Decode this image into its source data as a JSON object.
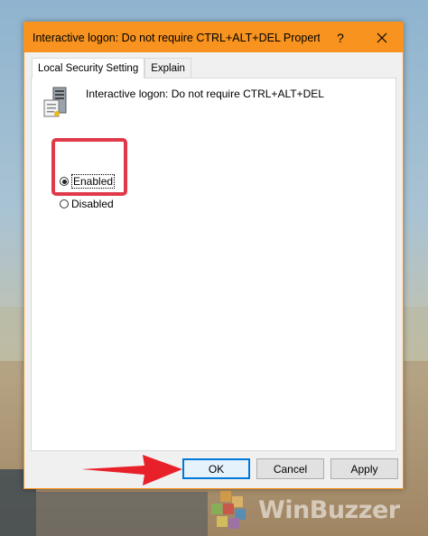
{
  "dialog": {
    "title": "Interactive logon: Do not require CTRL+ALT+DEL Properti...",
    "help_label": "?",
    "accent_color": "#f7931e"
  },
  "tabs": [
    {
      "label": "Local Security Setting",
      "active": true
    },
    {
      "label": "Explain",
      "active": false
    }
  ],
  "policy": {
    "icon": "server-policy-icon",
    "name": "Interactive logon: Do not require CTRL+ALT+DEL"
  },
  "options": [
    {
      "label": "Enabled",
      "selected": true
    },
    {
      "label": "Disabled",
      "selected": false
    }
  ],
  "buttons": {
    "ok": "OK",
    "cancel": "Cancel",
    "apply": "Apply"
  },
  "annotation": {
    "highlight_color": "#e03a4a",
    "arrow_color": "#e8202a"
  },
  "watermark": {
    "text": "WinBuzzer"
  }
}
